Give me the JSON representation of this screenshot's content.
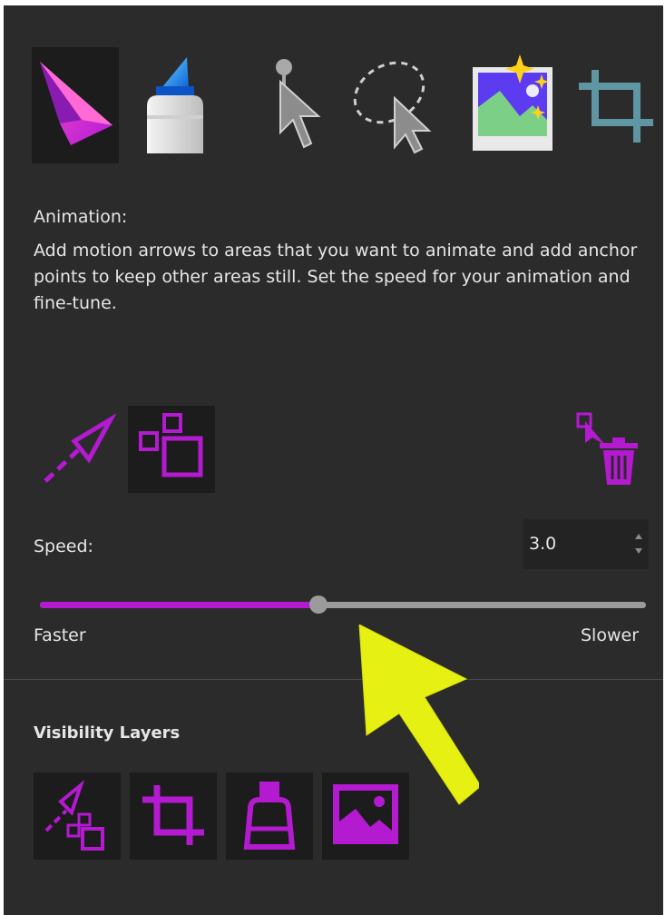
{
  "toolbar": {
    "tools": [
      {
        "icon": "paper-plane-animation-icon",
        "selected": true
      },
      {
        "icon": "highlighter-marker-icon",
        "selected": false
      },
      {
        "icon": "pin-pointer-icon",
        "selected": false
      },
      {
        "icon": "lasso-selection-icon",
        "selected": false
      },
      {
        "icon": "sparkle-photo-icon",
        "selected": false
      },
      {
        "icon": "crop-icon",
        "selected": false
      }
    ]
  },
  "description": {
    "title": "Animation:",
    "body": "Add motion arrows to areas that you want to animate and add anchor points to keep other areas still. Set the speed for your animation and fine-tune."
  },
  "subtools": {
    "items": [
      {
        "icon": "motion-arrow-icon",
        "selected": false
      },
      {
        "icon": "anchor-points-icon",
        "selected": true
      },
      {
        "icon": "delete-arrows-icon",
        "selected": false
      }
    ]
  },
  "speed": {
    "label": "Speed:",
    "value": "3.0",
    "slider_fraction": 0.46,
    "min_label": "Faster",
    "max_label": "Slower"
  },
  "visibility": {
    "title": "Visibility Layers",
    "layers": [
      {
        "icon": "arrows-anchors-layer-icon"
      },
      {
        "icon": "crop-layer-icon"
      },
      {
        "icon": "highlighter-layer-icon"
      },
      {
        "icon": "image-layer-icon"
      }
    ]
  },
  "colors": {
    "panel_bg": "#2b2b2b",
    "accent": "#b41ad0",
    "text": "#e6e6e6",
    "annotation_arrow": "#e6f012"
  }
}
